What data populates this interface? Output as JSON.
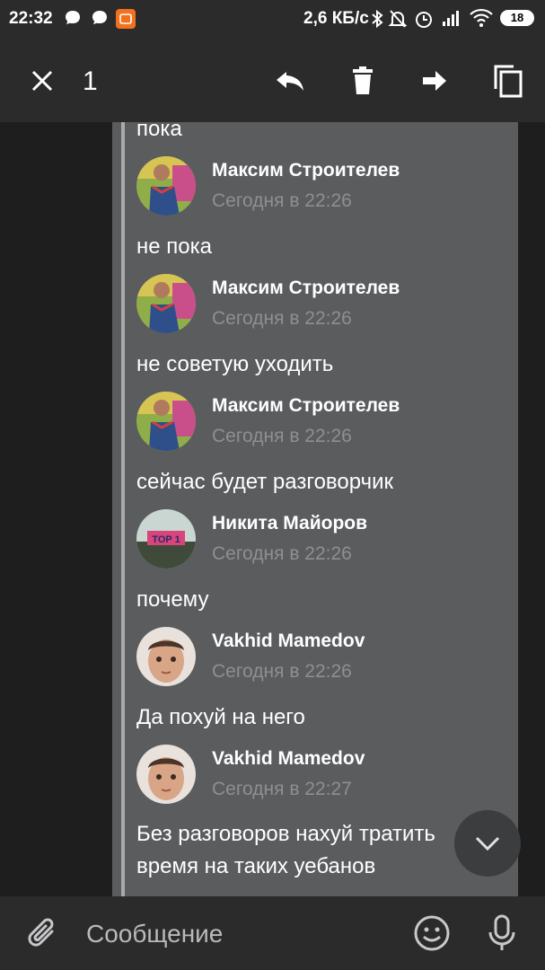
{
  "status_bar": {
    "time": "22:32",
    "net_speed": "2,6 КБ/с",
    "battery": "18",
    "icons": [
      "chat-bubble-icon",
      "chat-bubble-icon",
      "app-notification-icon",
      "bluetooth-icon",
      "mute-icon",
      "alarm-icon",
      "signal-icon",
      "wifi-icon"
    ]
  },
  "action_bar": {
    "selected_count": "1",
    "icons": [
      "close-icon",
      "reply-icon",
      "delete-icon",
      "forward-icon",
      "copy-icon"
    ]
  },
  "messages": [
    {
      "type": "text",
      "text": "пока"
    },
    {
      "type": "author",
      "name": "Максим Строителев",
      "time": "Сегодня в 22:26",
      "avatar": "maxim"
    },
    {
      "type": "text",
      "text": "не пока"
    },
    {
      "type": "author",
      "name": "Максим Строителев",
      "time": "Сегодня в 22:26",
      "avatar": "maxim"
    },
    {
      "type": "text",
      "text": "не советую уходить"
    },
    {
      "type": "author",
      "name": "Максим Строителев",
      "time": "Сегодня в 22:26",
      "avatar": "maxim"
    },
    {
      "type": "text",
      "text": "сейчас будет разговорчик"
    },
    {
      "type": "author",
      "name": "Никита Майоров",
      "time": "Сегодня в 22:26",
      "avatar": "nikita",
      "avatar_text": "TOP 1"
    },
    {
      "type": "text",
      "text": "почему"
    },
    {
      "type": "author",
      "name": "Vakhid Mamedov",
      "time": "Сегодня в 22:26",
      "avatar": "vakhid"
    },
    {
      "type": "text",
      "text": "Да похуй на него"
    },
    {
      "type": "author",
      "name": "Vakhid Mamedov",
      "time": "Сегодня в 22:27",
      "avatar": "vakhid"
    },
    {
      "type": "text",
      "text": "Без разговоров нахуй тратить"
    },
    {
      "type": "text",
      "text": "время на таких уебанов"
    }
  ],
  "input": {
    "placeholder": "Сообщение",
    "icons": [
      "attach-icon",
      "emoji-icon",
      "microphone-icon"
    ]
  },
  "colors": {
    "bar_bg": "#2b2b2c",
    "selection_bg": "#5b5c5e",
    "time_text": "#8e8f91"
  }
}
